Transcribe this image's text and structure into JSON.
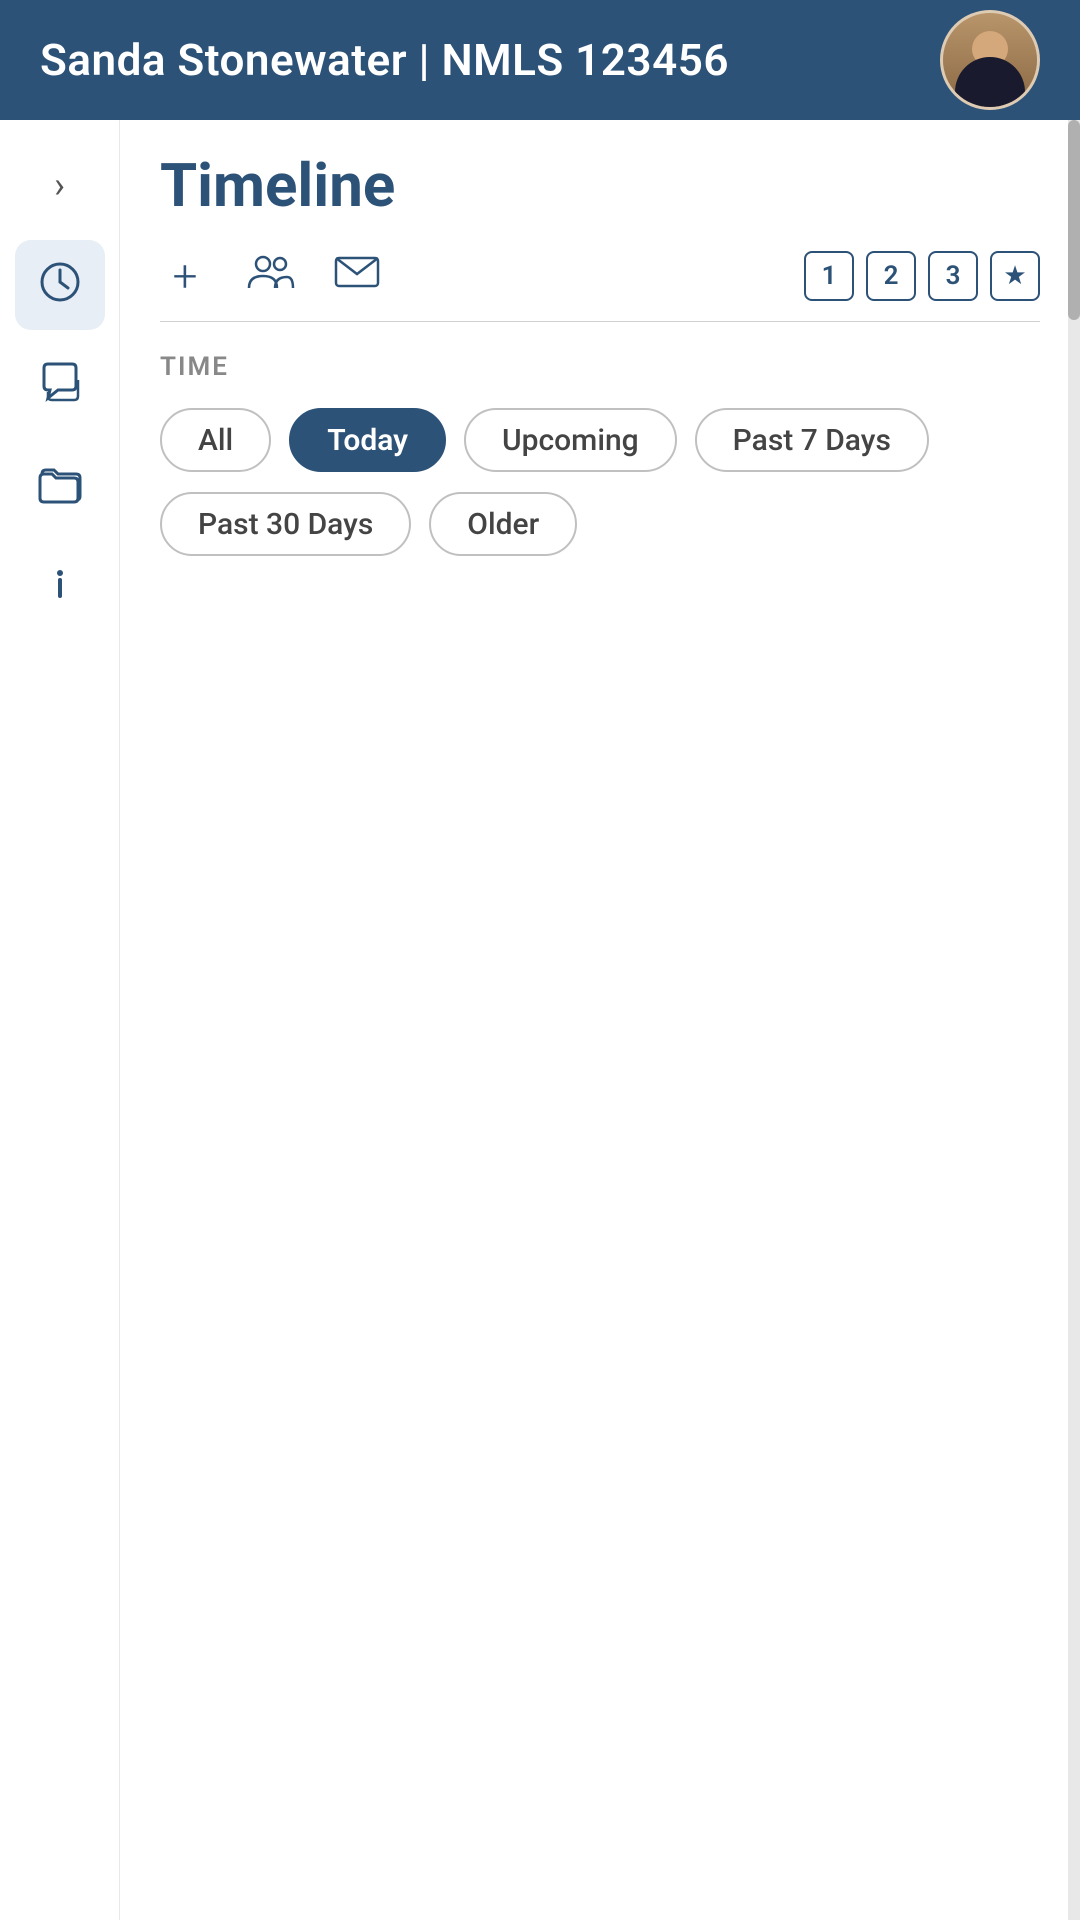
{
  "header": {
    "title": "Sanda Stonewater | NMLS 123456",
    "avatar_alt": "Sanda Stonewater profile photo"
  },
  "sidebar": {
    "items": [
      {
        "id": "expand",
        "icon": "›",
        "label": "expand-icon",
        "active": false
      },
      {
        "id": "timeline",
        "icon": "clock",
        "label": "timeline-icon",
        "active": true
      },
      {
        "id": "messages",
        "icon": "chat",
        "label": "messages-icon",
        "active": false
      },
      {
        "id": "folders",
        "icon": "folder",
        "label": "folders-icon",
        "active": false
      },
      {
        "id": "info",
        "icon": "info",
        "label": "info-icon",
        "active": false
      }
    ]
  },
  "main": {
    "page_title": "Timeline",
    "toolbar": {
      "add_label": "+",
      "badge1": "1",
      "badge2": "2",
      "badge3": "3"
    },
    "filter_section": {
      "label": "TIME",
      "chips": [
        {
          "id": "all",
          "label": "All",
          "active": false
        },
        {
          "id": "today",
          "label": "Today",
          "active": true
        },
        {
          "id": "upcoming",
          "label": "Upcoming",
          "active": false
        },
        {
          "id": "past7",
          "label": "Past 7 Days",
          "active": false
        },
        {
          "id": "past30",
          "label": "Past 30 Days",
          "active": false
        },
        {
          "id": "older",
          "label": "Older",
          "active": false
        }
      ]
    }
  }
}
